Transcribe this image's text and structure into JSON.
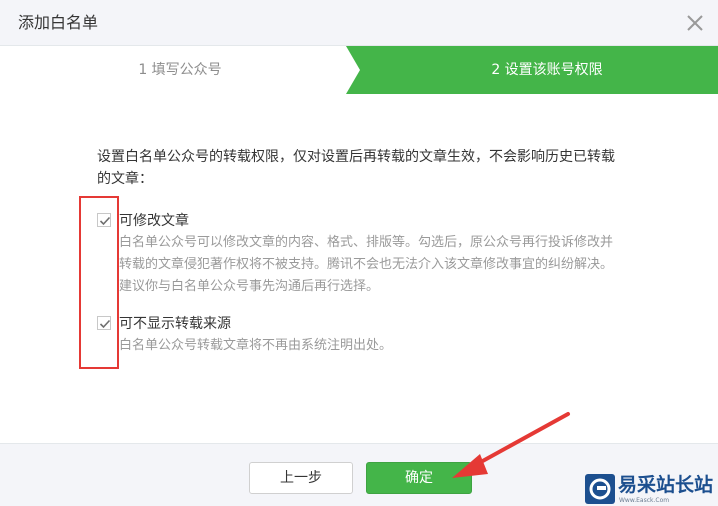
{
  "dialog": {
    "title": "添加白名单",
    "close_icon": "close-icon"
  },
  "steps": [
    {
      "label": "1 填写公众号",
      "active": false
    },
    {
      "label": "2 设置该账号权限",
      "active": true
    }
  ],
  "content": {
    "intro": "设置白名单公众号的转载权限，仅对设置后再转载的文章生效，不会影响历史已转载的文章：",
    "options": [
      {
        "title": "可修改文章",
        "checked": true,
        "description": "白名单公众号可以修改文章的内容、格式、排版等。勾选后，原公众号再行投诉修改并转载的文章侵犯著作权将不被支持。腾讯不会也无法介入该文章修改事宜的纠纷解决。建议你与白名单公众号事先沟通后再行选择。"
      },
      {
        "title": "可不显示转载来源",
        "checked": true,
        "description": "白名单公众号转载文章将不再由系统注明出处。"
      }
    ]
  },
  "footer": {
    "prev_label": "上一步",
    "ok_label": "确定"
  },
  "watermark": {
    "text": "易采站长站",
    "sub": "Www.Easck.Com"
  },
  "colors": {
    "accent": "#44b549",
    "annotation": "#e53935",
    "header_bg": "#f4f5f9",
    "watermark": "#1c4f8f"
  }
}
